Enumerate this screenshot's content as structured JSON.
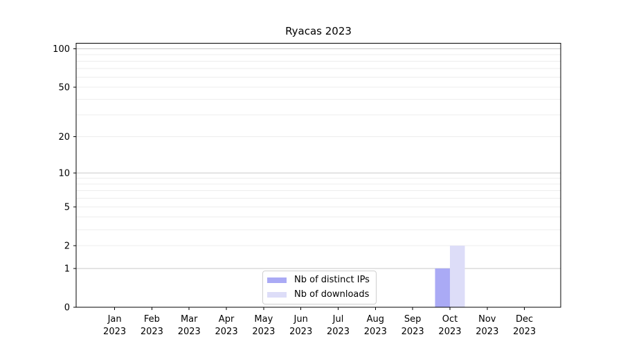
{
  "title": "Ryacas 2023",
  "legend": {
    "items": [
      {
        "label": "Nb of distinct IPs",
        "color": "#aaaaf5"
      },
      {
        "label": "Nb of downloads",
        "color": "#ddddf8"
      }
    ]
  },
  "chart_data": {
    "type": "bar",
    "title": "Ryacas 2023",
    "categories": [
      "Jan",
      "Feb",
      "Mar",
      "Apr",
      "May",
      "Jun",
      "Jul",
      "Aug",
      "Sep",
      "Oct",
      "Nov",
      "Dec"
    ],
    "category_year": "2023",
    "series": [
      {
        "name": "Nb of distinct IPs",
        "color": "#aaaaf5",
        "values": [
          0,
          0,
          0,
          0,
          0,
          0,
          0,
          0,
          0,
          1,
          0,
          0
        ]
      },
      {
        "name": "Nb of downloads",
        "color": "#ddddf8",
        "values": [
          0,
          0,
          0,
          0,
          0,
          0,
          0,
          0,
          0,
          2,
          0,
          0
        ]
      }
    ],
    "y_scale": "log1p",
    "ylim": [
      0,
      110
    ],
    "y_ticks": [
      0,
      1,
      2,
      5,
      10,
      20,
      50,
      100
    ],
    "major_gridlines": [
      1,
      10,
      100
    ],
    "minor_gridlines": [
      2,
      3,
      4,
      5,
      6,
      7,
      8,
      9,
      20,
      30,
      40,
      50,
      60,
      70,
      80,
      90
    ],
    "grid": true,
    "legend_position": "lower center",
    "colors": {
      "major_grid": "#c8c8c8",
      "minor_grid": "#ededed",
      "axis": "#000000",
      "text": "#000000"
    }
  }
}
